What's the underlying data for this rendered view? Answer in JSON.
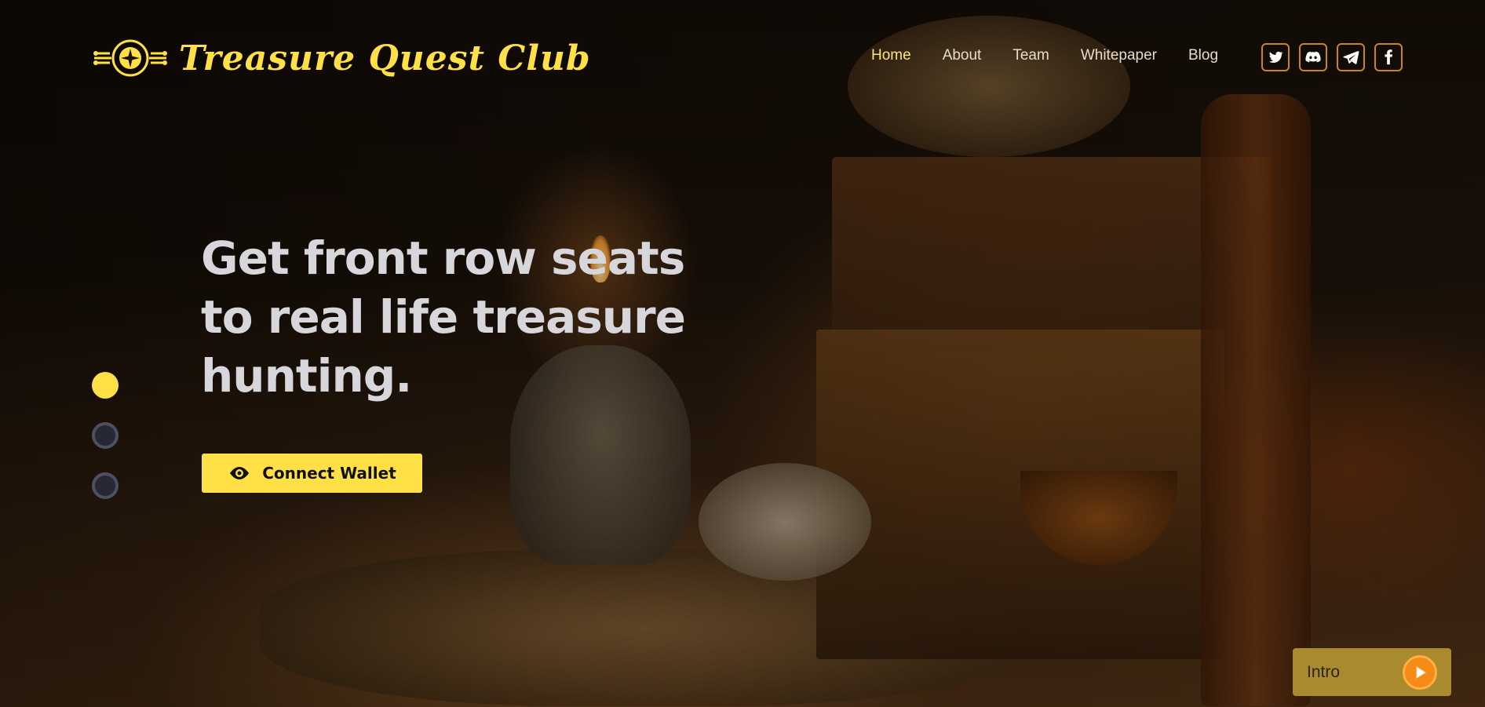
{
  "brand": {
    "name": "Treasure Quest Club",
    "logo_icon": "compass-emblem-icon"
  },
  "nav": {
    "items": [
      {
        "label": "Home",
        "active": true
      },
      {
        "label": "About",
        "active": false
      },
      {
        "label": "Team",
        "active": false
      },
      {
        "label": "Whitepaper",
        "active": false
      },
      {
        "label": "Blog",
        "active": false
      }
    ]
  },
  "socials": [
    {
      "icon": "twitter-icon"
    },
    {
      "icon": "discord-icon"
    },
    {
      "icon": "telegram-icon"
    },
    {
      "icon": "facebook-icon"
    }
  ],
  "hero": {
    "title": "Get front row seats to real life treasure hunting.",
    "cta_label": "Connect Wallet",
    "cta_icon": "eye-icon"
  },
  "slider": {
    "count": 3,
    "active_index": 0
  },
  "intro": {
    "label": "Intro",
    "icon": "play-icon"
  },
  "colors": {
    "accent": "#ffe047",
    "nav_active": "#ffe47a",
    "social_border": "#c8861c",
    "intro_bg": "#a98a2f",
    "play": "#f58a16"
  }
}
